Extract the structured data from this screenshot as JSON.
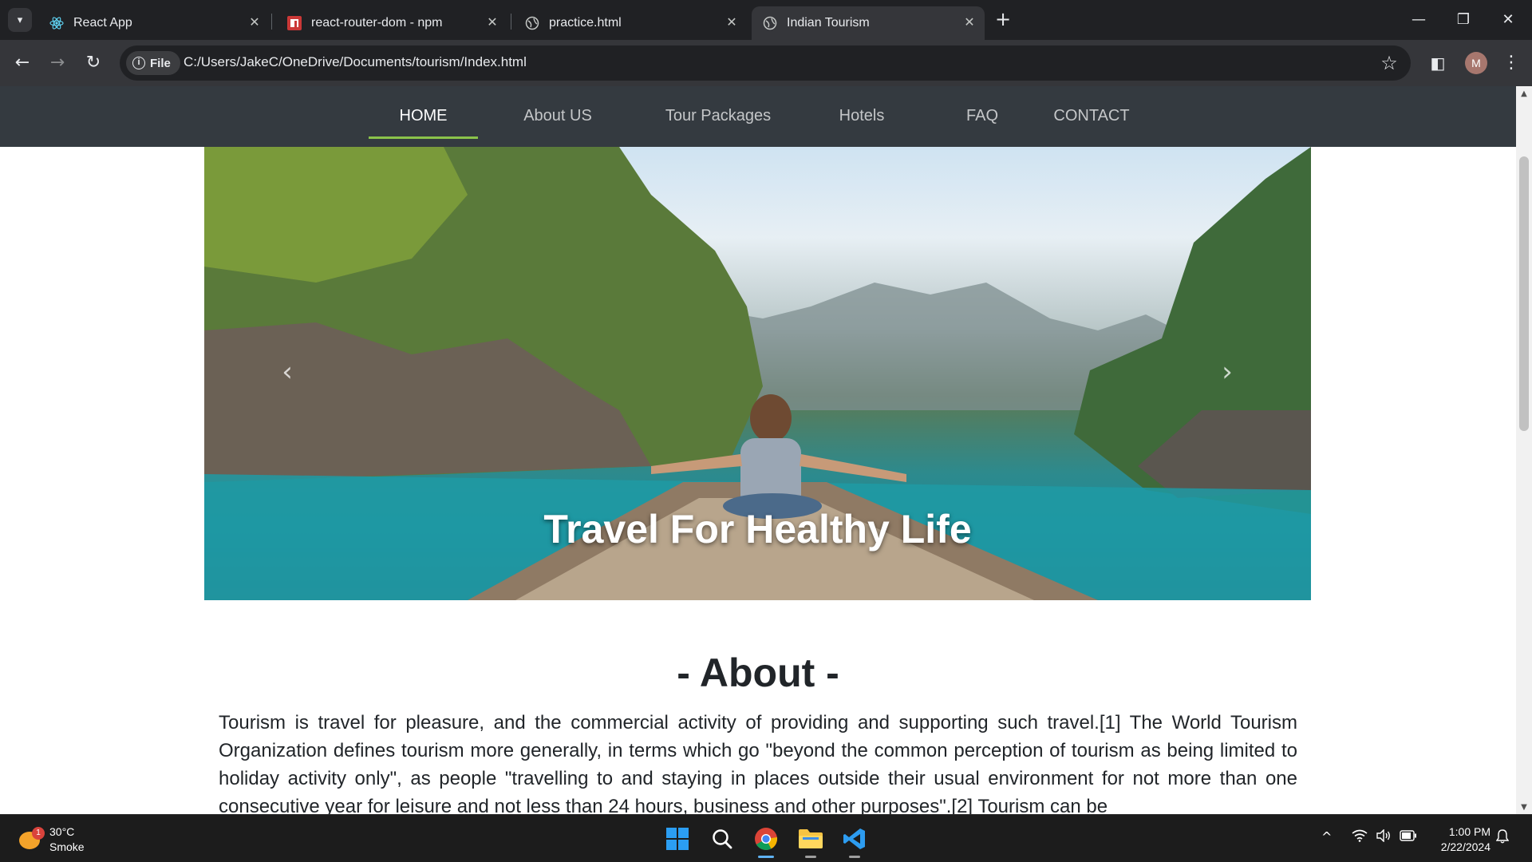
{
  "browser": {
    "tabs": [
      {
        "title": "React App",
        "icon": "react-icon",
        "active": false
      },
      {
        "title": "react-router-dom - npm",
        "icon": "npm-icon",
        "active": false
      },
      {
        "title": "practice.html",
        "icon": "globe-icon",
        "active": false
      },
      {
        "title": "Indian Tourism",
        "icon": "globe-icon",
        "active": true
      }
    ],
    "address_chip": "File",
    "url": "C:/Users/JakeC/OneDrive/Documents/tourism/Index.html",
    "profile_initial": "M"
  },
  "site": {
    "nav": [
      {
        "label": "HOME",
        "active": true
      },
      {
        "label": "About US",
        "active": false
      },
      {
        "label": "Tour Packages",
        "active": false
      },
      {
        "label": "Hotels",
        "active": false
      },
      {
        "label": "FAQ",
        "active": false
      },
      {
        "label": "CONTACT",
        "active": false
      }
    ],
    "hero_caption": "Travel For Healthy Life",
    "about_title": "- About -",
    "about_text": "Tourism is travel for pleasure, and the commercial activity of providing and supporting such travel.[1] The World Tourism Organization defines tourism more generally, in terms which go \"beyond the common perception of tourism as being limited to holiday activity only\", as people \"travelling to and staying in places outside their usual environment for not more than one consecutive year for leisure and not less than 24 hours, business and other purposes\".[2] Tourism can be"
  },
  "taskbar": {
    "weather_badge": "1",
    "temperature": "30°C",
    "condition": "Smoke",
    "time": "1:00 PM",
    "date": "2/22/2024"
  },
  "colors": {
    "site_nav_bg": "#343a40",
    "nav_active_underline": "#8bc34a",
    "browser_frame": "#202124"
  }
}
